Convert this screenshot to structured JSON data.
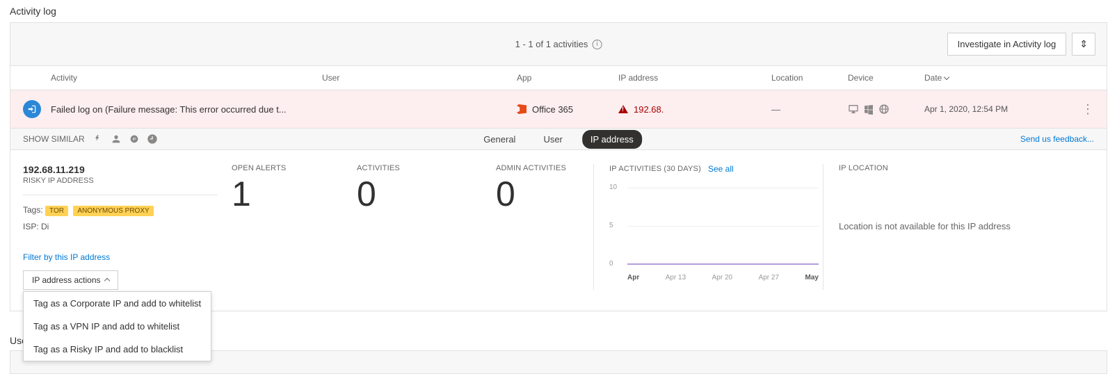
{
  "page_title": "Activity log",
  "toolbar": {
    "count_text": "1 - 1 of 1 activities",
    "investigate_label": "Investigate in Activity log"
  },
  "columns": {
    "activity": "Activity",
    "user": "User",
    "app": "App",
    "ip": "IP address",
    "location": "Location",
    "device": "Device",
    "date": "Date"
  },
  "row": {
    "activity": "Failed log on (Failure message: This error occurred due t...",
    "user": "",
    "app": "Office 365",
    "ip": "192.68.",
    "location": "—",
    "date": "Apr 1, 2020, 12:54 PM"
  },
  "subbar": {
    "show_similar": "SHOW SIMILAR",
    "tabs": {
      "general": "General",
      "user": "User",
      "ip": "IP address"
    },
    "feedback": "Send us feedback..."
  },
  "ipinfo": {
    "ip_full": "192.68.11.219",
    "subtitle": "RISKY IP ADDRESS",
    "tags_label": "Tags:",
    "tag1": "TOR",
    "tag2": "ANONYMOUS PROXY",
    "isp": "ISP: Di",
    "filter_link": "Filter by this IP address",
    "actions_btn": "IP address actions",
    "menu": {
      "opt1": "Tag as a Corporate IP and add to whitelist",
      "opt2": "Tag as a VPN IP and add to whitelist",
      "opt3": "Tag as a Risky IP and add to blacklist"
    }
  },
  "metrics": {
    "open_alerts_label": "OPEN ALERTS",
    "open_alerts_value": "1",
    "activities_label": "ACTIVITIES",
    "activities_value": "0",
    "admin_label": "ADMIN ACTIVITIES",
    "admin_value": "0"
  },
  "chart": {
    "title": "IP ACTIVITIES (30 DAYS)",
    "see_all": "See all",
    "y10": "10",
    "y5": "5",
    "y0": "0",
    "x1": "Apr",
    "x2": "Apr 13",
    "x3": "Apr 20",
    "x4": "Apr 27",
    "x5": "May"
  },
  "chart_data": {
    "type": "line",
    "title": "IP ACTIVITIES (30 DAYS)",
    "xlabel": "",
    "ylabel": "",
    "ylim": [
      0,
      10
    ],
    "categories": [
      "Apr",
      "Apr 13",
      "Apr 20",
      "Apr 27",
      "May"
    ],
    "series": [
      {
        "name": "IP activities",
        "values": [
          0,
          0,
          0,
          0,
          0
        ]
      }
    ]
  },
  "location_panel": {
    "title": "IP LOCATION",
    "message": "Location is not available for this IP address"
  },
  "section2_title": "User"
}
